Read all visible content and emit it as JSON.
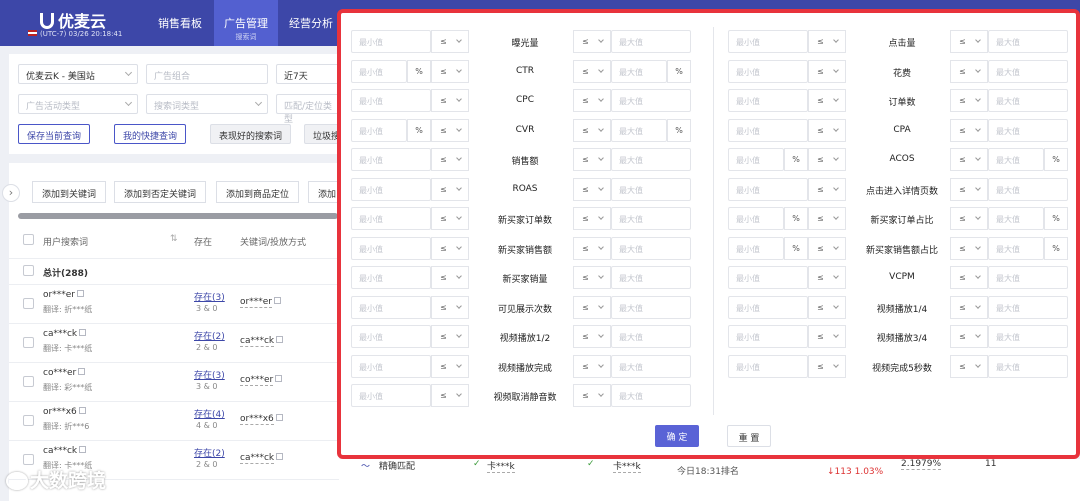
{
  "app": {
    "name": "优麦云",
    "timezone": "(UTC-7) 03/26 20:18:41"
  },
  "nav": [
    {
      "label": "销售看板",
      "sub": ""
    },
    {
      "label": "广告管理",
      "sub": "搜索词"
    },
    {
      "label": "经营分析",
      "sub": ""
    }
  ],
  "filters": {
    "store": "优麦云K - 美国站",
    "ad_group_placeholder": "广告组合",
    "date_range": "近7天",
    "campaign_type_placeholder": "广告活动类型",
    "search_term_type_placeholder": "搜索词类型",
    "match_placeholder": "匹配/定位类型",
    "save_query": "保存当前查询",
    "my_quick_query": "我的快捷查询",
    "good_terms": "表现好的搜索词",
    "junk_terms": "垃圾搜"
  },
  "table_actions": [
    "添加到关键词",
    "添加到否定关键词",
    "添加到商品定位",
    "添加"
  ],
  "table": {
    "columns": {
      "term": "用户搜索词",
      "exists": "存在",
      "kw": "关键词/投放方式"
    },
    "total": "总计(288)",
    "rows": [
      {
        "term": "or***er",
        "trans": "翻译: 折***纸",
        "exists": "存在(3)",
        "count": "3 & 0",
        "kw": "or***er"
      },
      {
        "term": "ca***ck",
        "trans": "翻译: 卡***纸",
        "exists": "存在(2)",
        "count": "2 & 0",
        "kw": "ca***ck"
      },
      {
        "term": "co***er",
        "trans": "翻译: 彩***纸",
        "exists": "存在(3)",
        "count": "3 & 0",
        "kw": "co***er"
      },
      {
        "term": "or***x6",
        "trans": "翻译: 折***6",
        "exists": "存在(4)",
        "count": "4 & 0",
        "kw": "or***x6"
      },
      {
        "term": "ca***ck",
        "trans": "翻译: 卡***纸",
        "exists": "存在(2)",
        "count": "2 & 0",
        "kw": "ca***ck"
      }
    ]
  },
  "modal": {
    "placeholders": {
      "min": "最小值",
      "max": "最大值"
    },
    "operator": "≤",
    "percent": "%",
    "left_metrics": [
      {
        "label": "曝光量",
        "pct": false
      },
      {
        "label": "CTR",
        "pct": true
      },
      {
        "label": "CPC",
        "pct": false
      },
      {
        "label": "CVR",
        "pct": true
      },
      {
        "label": "销售额",
        "pct": false
      },
      {
        "label": "ROAS",
        "pct": false
      },
      {
        "label": "新买家订单数",
        "pct": false
      },
      {
        "label": "新买家销售额",
        "pct": false
      },
      {
        "label": "新买家销量",
        "pct": false
      },
      {
        "label": "可见展示次数",
        "pct": false
      },
      {
        "label": "视频播放1/2",
        "pct": false
      },
      {
        "label": "视频播放完成",
        "pct": false
      },
      {
        "label": "视频取消静音数",
        "pct": false
      }
    ],
    "right_metrics": [
      {
        "label": "点击量",
        "pct": false
      },
      {
        "label": "花费",
        "pct": false
      },
      {
        "label": "订单数",
        "pct": false
      },
      {
        "label": "CPA",
        "pct": false
      },
      {
        "label": "ACOS",
        "pct": true
      },
      {
        "label": "点击进入详情页数",
        "pct": false
      },
      {
        "label": "新买家订单占比",
        "pct": true
      },
      {
        "label": "新买家销售额占比",
        "pct": true
      },
      {
        "label": "VCPM",
        "pct": false
      },
      {
        "label": "视频播放1/4",
        "pct": false
      },
      {
        "label": "视频播放3/4",
        "pct": false
      },
      {
        "label": "视频完成5秒数",
        "pct": false
      }
    ],
    "confirm": "确 定",
    "reset": "重 置"
  },
  "behind_modal": {
    "match": "精确匹配",
    "kw1": "卡***k",
    "kw2": "卡***k",
    "rank": "今日18:31排名",
    "drop": "113",
    "drop_pct": "1.03%",
    "ratio": "2.1979%",
    "num": "11"
  },
  "watermark": "大数跨境",
  "colors": {
    "primary": "#3d47a8",
    "accent": "#5a63d6",
    "highlight": "#e8333c"
  }
}
